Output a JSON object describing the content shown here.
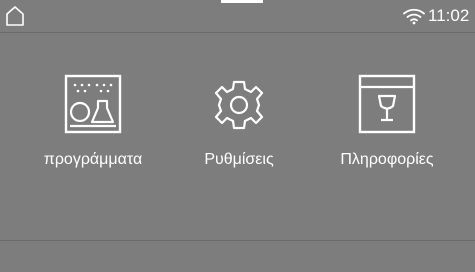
{
  "status": {
    "time": "11:02",
    "icons": [
      "home-icon",
      "wifi-icon"
    ]
  },
  "tiles": [
    {
      "label": "προγράμματα",
      "icon": "dishwasher-programs-icon"
    },
    {
      "label": "Ρυθμίσεις",
      "icon": "gear-icon"
    },
    {
      "label": "Πληροφορίες",
      "icon": "info-glass-icon"
    }
  ],
  "colors": {
    "background": "#7d7d7d",
    "foreground": "#ffffff"
  }
}
